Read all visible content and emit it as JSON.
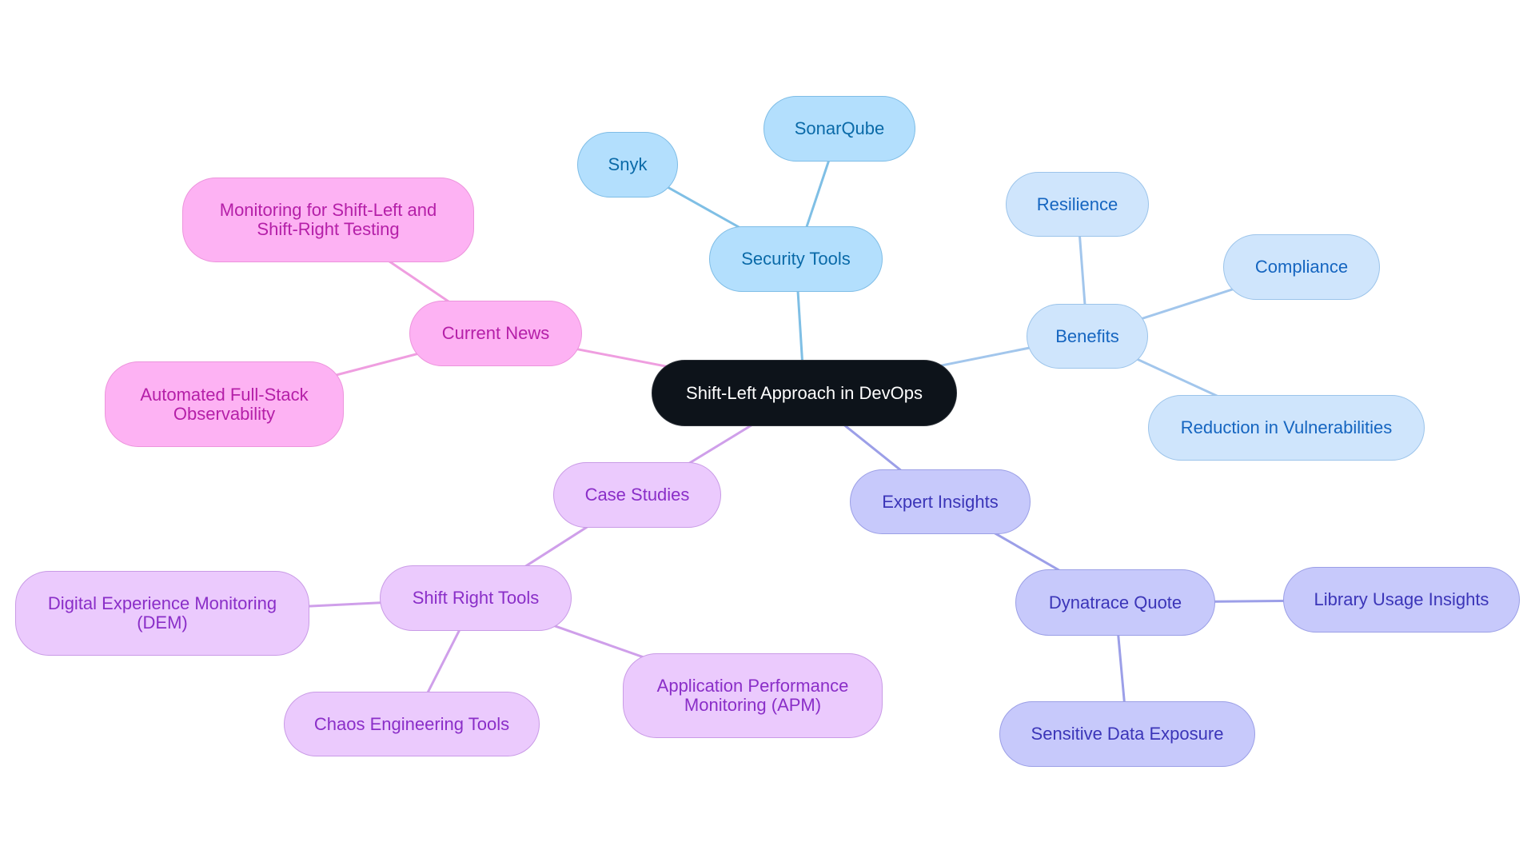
{
  "title": "Shift-Left Approach in DevOps",
  "branch_styles": {
    "root": {
      "fill": "#0d131a",
      "stroke": "#2a2f36",
      "text": "#ffffff",
      "edge": "#000000"
    },
    "security": {
      "fill": "#b3dffd",
      "stroke": "#7fbde6",
      "text": "#0a6aa8",
      "edge": "#7fbfe5"
    },
    "benefits": {
      "fill": "#cfe5fc",
      "stroke": "#9cc4ea",
      "text": "#1565c0",
      "edge": "#a2c6ec"
    },
    "news": {
      "fill": "#fdb2f3",
      "stroke": "#ec94dc",
      "text": "#b51fa8",
      "edge": "#ef9ee0"
    },
    "cases": {
      "fill": "#ebcafd",
      "stroke": "#c99be6",
      "text": "#8a2ec8",
      "edge": "#cf9fea"
    },
    "expert": {
      "fill": "#c7c9fb",
      "stroke": "#9b9fe6",
      "text": "#3b35b8",
      "edge": "#9c9fe8"
    }
  },
  "nodes": [
    {
      "id": "root",
      "label": "Shift-Left Approach in DevOps",
      "branch": "root"
    },
    {
      "id": "security-tools",
      "label": "Security Tools",
      "branch": "security",
      "parent": "root"
    },
    {
      "id": "snyk",
      "label": "Snyk",
      "branch": "security",
      "parent": "security-tools"
    },
    {
      "id": "sonarqube",
      "label": "SonarQube",
      "branch": "security",
      "parent": "security-tools"
    },
    {
      "id": "benefits",
      "label": "Benefits",
      "branch": "benefits",
      "parent": "root"
    },
    {
      "id": "resilience",
      "label": "Resilience",
      "branch": "benefits",
      "parent": "benefits"
    },
    {
      "id": "compliance",
      "label": "Compliance",
      "branch": "benefits",
      "parent": "benefits"
    },
    {
      "id": "reduction",
      "label": "Reduction in Vulnerabilities",
      "branch": "benefits",
      "parent": "benefits"
    },
    {
      "id": "current-news",
      "label": "Current News",
      "branch": "news",
      "parent": "root"
    },
    {
      "id": "monitoring",
      "label": "Monitoring for Shift-Left and\nShift-Right Testing",
      "branch": "news",
      "parent": "current-news"
    },
    {
      "id": "automated",
      "label": "Automated Full-Stack\nObservability",
      "branch": "news",
      "parent": "current-news"
    },
    {
      "id": "case-studies",
      "label": "Case Studies",
      "branch": "cases",
      "parent": "root"
    },
    {
      "id": "shift-right",
      "label": "Shift Right Tools",
      "branch": "cases",
      "parent": "case-studies"
    },
    {
      "id": "dem",
      "label": "Digital Experience Monitoring\n(DEM)",
      "branch": "cases",
      "parent": "shift-right"
    },
    {
      "id": "chaos",
      "label": "Chaos Engineering Tools",
      "branch": "cases",
      "parent": "shift-right"
    },
    {
      "id": "apm",
      "label": "Application Performance\nMonitoring (APM)",
      "branch": "cases",
      "parent": "shift-right"
    },
    {
      "id": "expert-insights",
      "label": "Expert Insights",
      "branch": "expert",
      "parent": "root"
    },
    {
      "id": "dynatrace",
      "label": "Dynatrace Quote",
      "branch": "expert",
      "parent": "expert-insights"
    },
    {
      "id": "library",
      "label": "Library Usage Insights",
      "branch": "expert",
      "parent": "dynatrace"
    },
    {
      "id": "sensitive",
      "label": "Sensitive Data Exposure",
      "branch": "expert",
      "parent": "dynatrace"
    }
  ]
}
